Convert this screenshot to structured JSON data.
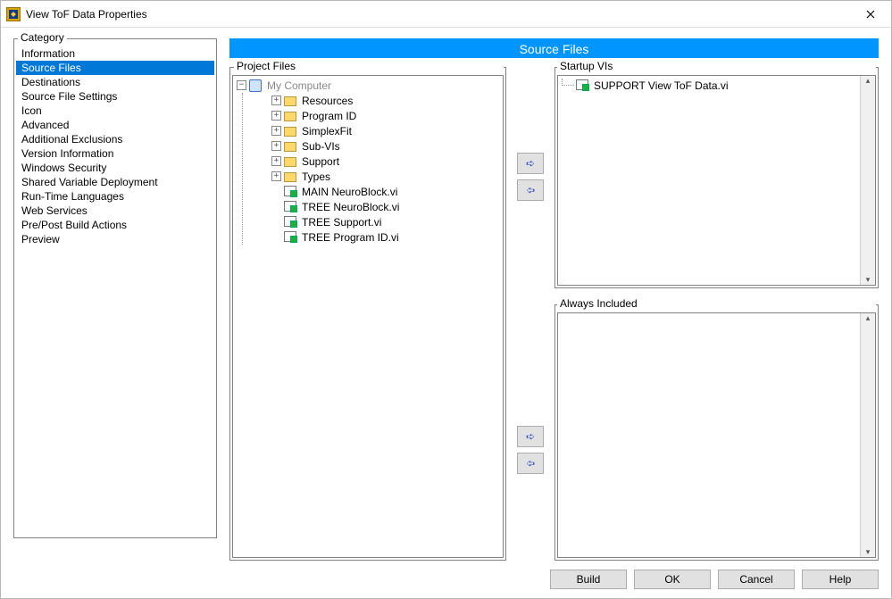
{
  "window": {
    "title": "View ToF Data Properties"
  },
  "category": {
    "label": "Category",
    "selected": "Source Files",
    "items": [
      "Information",
      "Source Files",
      "Destinations",
      "Source File Settings",
      "Icon",
      "Advanced",
      "Additional Exclusions",
      "Version Information",
      "Windows Security",
      "Shared Variable Deployment",
      "Run-Time Languages",
      "Web Services",
      "Pre/Post Build Actions",
      "Preview"
    ]
  },
  "banner": "Source Files",
  "project": {
    "label": "Project Files",
    "root": "My Computer",
    "folders": [
      "Resources",
      "Program ID",
      "SimplexFit",
      "Sub-VIs",
      "Support",
      "Types"
    ],
    "vis": [
      "MAIN NeuroBlock.vi",
      "TREE NeuroBlock.vi",
      "TREE Support.vi",
      "TREE Program ID.vi"
    ]
  },
  "startup": {
    "label": "Startup VIs",
    "items": [
      "SUPPORT View ToF Data.vi"
    ]
  },
  "always": {
    "label": "Always Included",
    "items": []
  },
  "buttons": {
    "build": "Build",
    "ok": "OK",
    "cancel": "Cancel",
    "help": "Help"
  }
}
